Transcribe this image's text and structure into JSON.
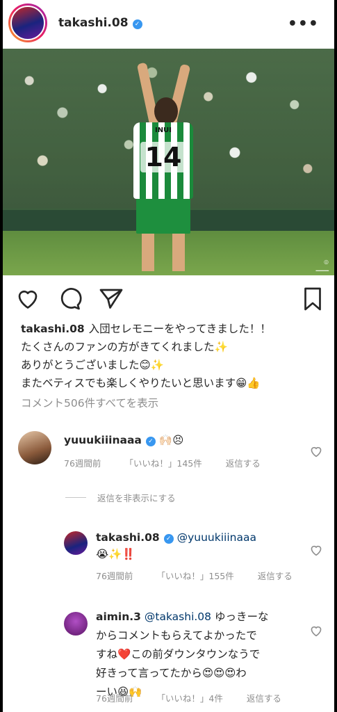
{
  "header": {
    "username": "takashi.08",
    "more_label": "•••"
  },
  "photo": {
    "jersey_name": "INUI",
    "jersey_number": "14"
  },
  "caption": {
    "username": "takashi.08",
    "lines": [
      "入団セレモニーをやってきました！！",
      "たくさんのファンの方がきてくれました✨",
      "ありがとうございました😊✨",
      "またベティスでも楽しくやりたいと思います😁👍"
    ],
    "view_all": "コメント506件すべてを表示"
  },
  "comments": [
    {
      "username": "yuuukiiinaaa",
      "text": "🙌🏻😣",
      "time": "76週間前",
      "likes": "「いいね！」145件",
      "reply": "返信する"
    },
    {
      "username": "takashi.08",
      "mention": "@yuuukiiinaaa",
      "text": "😭✨‼️",
      "time": "76週間前",
      "likes": "「いいね！」155件",
      "reply": "返信する"
    },
    {
      "username": "aimin.3",
      "mention": "@takashi.08",
      "text_1": "ゆっきーな",
      "text_2": "からコメントもらえてよかったで",
      "text_3": "すね❤️この前ダウンタウンなうで",
      "text_4": "好きって言ってたから😍😍😍わ",
      "text_5": "ーい😆🙌",
      "time": "76週間前",
      "likes": "「いいね！」4件",
      "reply": "返信する"
    }
  ],
  "hide_replies": "返信を非表示にする",
  "colors": {
    "verified": "#3897f0",
    "meta_gray": "#8e8e8e",
    "mention": "#00376b"
  }
}
